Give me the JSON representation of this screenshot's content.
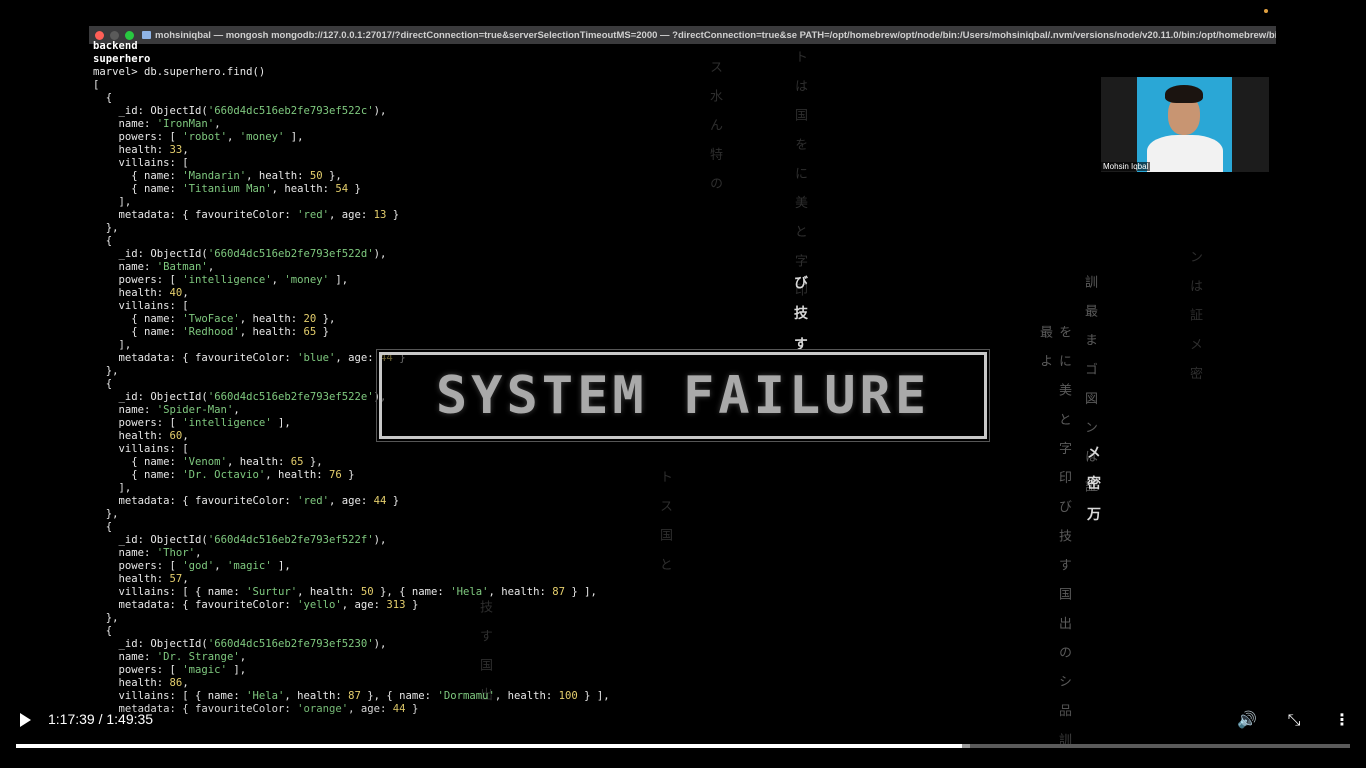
{
  "window": {
    "title": "mohsiniqbal — mongosh mongodb://127.0.0.1:27017/?directConnection=true&serverSelectionTimeoutMS=2000 — ?directConnection=true&se PATH=/opt/homebrew/opt/node/bin:/Users/mohsiniqbal/.nvm/versions/node/v20.11.0/bin:/opt/homebrew/bin:/opt/h..."
  },
  "terminal": {
    "lines": [
      [
        {
          "t": "backend",
          "c": "bold"
        }
      ],
      [
        {
          "t": "superhero",
          "c": "bold"
        }
      ],
      [
        {
          "t": "marvel> db.superhero.find()"
        }
      ],
      [
        {
          "t": "["
        }
      ],
      [
        {
          "t": "  {"
        }
      ],
      [
        {
          "t": "    _id: ObjectId("
        },
        {
          "t": "'660d4dc516eb2fe793ef522c'",
          "c": "str"
        },
        {
          "t": "),"
        }
      ],
      [
        {
          "t": "    name: "
        },
        {
          "t": "'IronMan'",
          "c": "str"
        },
        {
          "t": ","
        }
      ],
      [
        {
          "t": "    powers: [ "
        },
        {
          "t": "'robot'",
          "c": "str"
        },
        {
          "t": ", "
        },
        {
          "t": "'money'",
          "c": "str"
        },
        {
          "t": " ],"
        }
      ],
      [
        {
          "t": "    health: "
        },
        {
          "t": "33",
          "c": "num"
        },
        {
          "t": ","
        }
      ],
      [
        {
          "t": "    villains: ["
        }
      ],
      [
        {
          "t": "      { name: "
        },
        {
          "t": "'Mandarin'",
          "c": "str"
        },
        {
          "t": ", health: "
        },
        {
          "t": "50",
          "c": "num"
        },
        {
          "t": " },"
        }
      ],
      [
        {
          "t": "      { name: "
        },
        {
          "t": "'Titanium Man'",
          "c": "str"
        },
        {
          "t": ", health: "
        },
        {
          "t": "54",
          "c": "num"
        },
        {
          "t": " }"
        }
      ],
      [
        {
          "t": "    ],"
        }
      ],
      [
        {
          "t": "    metadata: { favouriteColor: "
        },
        {
          "t": "'red'",
          "c": "str"
        },
        {
          "t": ", age: "
        },
        {
          "t": "13",
          "c": "num"
        },
        {
          "t": " }"
        }
      ],
      [
        {
          "t": "  },"
        }
      ],
      [
        {
          "t": "  {"
        }
      ],
      [
        {
          "t": "    _id: ObjectId("
        },
        {
          "t": "'660d4dc516eb2fe793ef522d'",
          "c": "str"
        },
        {
          "t": "),"
        }
      ],
      [
        {
          "t": "    name: "
        },
        {
          "t": "'Batman'",
          "c": "str"
        },
        {
          "t": ","
        }
      ],
      [
        {
          "t": "    powers: [ "
        },
        {
          "t": "'intelligence'",
          "c": "str"
        },
        {
          "t": ", "
        },
        {
          "t": "'money'",
          "c": "str"
        },
        {
          "t": " ],"
        }
      ],
      [
        {
          "t": "    health: "
        },
        {
          "t": "40",
          "c": "num"
        },
        {
          "t": ","
        }
      ],
      [
        {
          "t": "    villains: ["
        }
      ],
      [
        {
          "t": "      { name: "
        },
        {
          "t": "'TwoFace'",
          "c": "str"
        },
        {
          "t": ", health: "
        },
        {
          "t": "20",
          "c": "num"
        },
        {
          "t": " },"
        }
      ],
      [
        {
          "t": "      { name: "
        },
        {
          "t": "'Redhood'",
          "c": "str"
        },
        {
          "t": ", health: "
        },
        {
          "t": "65",
          "c": "num"
        },
        {
          "t": " }"
        }
      ],
      [
        {
          "t": "    ],"
        }
      ],
      [
        {
          "t": "    metadata: { favouriteColor: "
        },
        {
          "t": "'blue'",
          "c": "str"
        },
        {
          "t": ", age: "
        },
        {
          "t": "44",
          "c": "num"
        },
        {
          "t": " }"
        }
      ],
      [
        {
          "t": "  },"
        }
      ],
      [
        {
          "t": "  {"
        }
      ],
      [
        {
          "t": "    _id: ObjectId("
        },
        {
          "t": "'660d4dc516eb2fe793ef522e'",
          "c": "str"
        },
        {
          "t": "),"
        }
      ],
      [
        {
          "t": "    name: "
        },
        {
          "t": "'Spider-Man'",
          "c": "str"
        },
        {
          "t": ","
        }
      ],
      [
        {
          "t": "    powers: [ "
        },
        {
          "t": "'intelligence'",
          "c": "str"
        },
        {
          "t": " ],"
        }
      ],
      [
        {
          "t": "    health: "
        },
        {
          "t": "60",
          "c": "num"
        },
        {
          "t": ","
        }
      ],
      [
        {
          "t": "    villains: ["
        }
      ],
      [
        {
          "t": "      { name: "
        },
        {
          "t": "'Venom'",
          "c": "str"
        },
        {
          "t": ", health: "
        },
        {
          "t": "65",
          "c": "num"
        },
        {
          "t": " },"
        }
      ],
      [
        {
          "t": "      { name: "
        },
        {
          "t": "'Dr. Octavio'",
          "c": "str"
        },
        {
          "t": ", health: "
        },
        {
          "t": "76",
          "c": "num"
        },
        {
          "t": " }"
        }
      ],
      [
        {
          "t": "    ],"
        }
      ],
      [
        {
          "t": "    metadata: { favouriteColor: "
        },
        {
          "t": "'red'",
          "c": "str"
        },
        {
          "t": ", age: "
        },
        {
          "t": "44",
          "c": "num"
        },
        {
          "t": " }"
        }
      ],
      [
        {
          "t": "  },"
        }
      ],
      [
        {
          "t": "  {"
        }
      ],
      [
        {
          "t": "    _id: ObjectId("
        },
        {
          "t": "'660d4dc516eb2fe793ef522f'",
          "c": "str"
        },
        {
          "t": "),"
        }
      ],
      [
        {
          "t": "    name: "
        },
        {
          "t": "'Thor'",
          "c": "str"
        },
        {
          "t": ","
        }
      ],
      [
        {
          "t": "    powers: [ "
        },
        {
          "t": "'god'",
          "c": "str"
        },
        {
          "t": ", "
        },
        {
          "t": "'magic'",
          "c": "str"
        },
        {
          "t": " ],"
        }
      ],
      [
        {
          "t": "    health: "
        },
        {
          "t": "57",
          "c": "num"
        },
        {
          "t": ","
        }
      ],
      [
        {
          "t": "    villains: [ { name: "
        },
        {
          "t": "'Surtur'",
          "c": "str"
        },
        {
          "t": ", health: "
        },
        {
          "t": "50",
          "c": "num"
        },
        {
          "t": " }, { name: "
        },
        {
          "t": "'Hela'",
          "c": "str"
        },
        {
          "t": ", health: "
        },
        {
          "t": "87",
          "c": "num"
        },
        {
          "t": " } ],"
        }
      ],
      [
        {
          "t": "    metadata: { favouriteColor: "
        },
        {
          "t": "'yello'",
          "c": "str"
        },
        {
          "t": ", age: "
        },
        {
          "t": "313",
          "c": "num"
        },
        {
          "t": " }"
        }
      ],
      [
        {
          "t": "  },"
        }
      ],
      [
        {
          "t": "  {"
        }
      ],
      [
        {
          "t": "    _id: ObjectId("
        },
        {
          "t": "'660d4dc516eb2fe793ef5230'",
          "c": "str"
        },
        {
          "t": "),"
        }
      ],
      [
        {
          "t": "    name: "
        },
        {
          "t": "'Dr. Strange'",
          "c": "str"
        },
        {
          "t": ","
        }
      ],
      [
        {
          "t": "    powers: [ "
        },
        {
          "t": "'magic'",
          "c": "str"
        },
        {
          "t": " ],"
        }
      ],
      [
        {
          "t": "    health: "
        },
        {
          "t": "86",
          "c": "num"
        },
        {
          "t": ","
        }
      ],
      [
        {
          "t": "    villains: [ { name: "
        },
        {
          "t": "'Hela'",
          "c": "str"
        },
        {
          "t": ", health: "
        },
        {
          "t": "87",
          "c": "num"
        },
        {
          "t": " }, { name: "
        },
        {
          "t": "'Dormamu'",
          "c": "str"
        },
        {
          "t": ", health: "
        },
        {
          "t": "100",
          "c": "num"
        },
        {
          "t": " } ],"
        }
      ],
      [
        {
          "t": "    metadata: { favouriteColor: "
        },
        {
          "t": "'orange'",
          "c": "str"
        },
        {
          "t": ", age: "
        },
        {
          "t": "44",
          "c": "num"
        },
        {
          "t": " }"
        }
      ]
    ]
  },
  "overlay": {
    "failure_text": "SYSTEM FAILURE"
  },
  "webcam": {
    "name": "Mohsin Iqbal"
  },
  "player": {
    "time_label": "1:17:39 / 1:49:35",
    "progress_fraction": 0.709,
    "buffered_fraction": 0.715
  },
  "colors": {
    "string": "#7fc97f",
    "number": "#e5cf6d",
    "progress": "#ffffff"
  }
}
